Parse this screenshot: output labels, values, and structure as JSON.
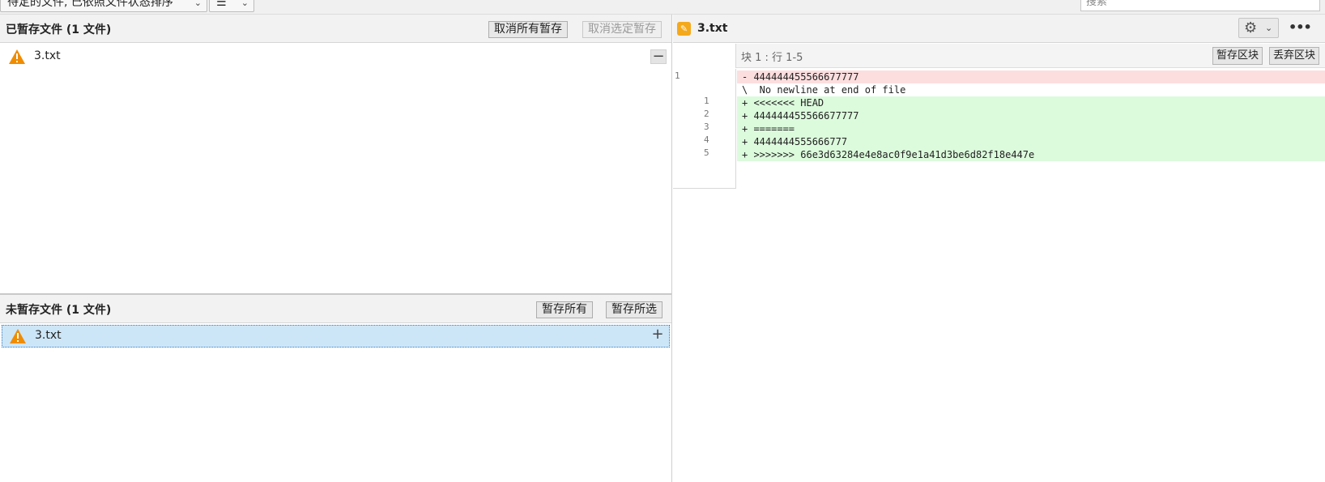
{
  "toolbar": {
    "sort_combo": "待定的文件, 已依照文件状态排序",
    "view_combo": "☰",
    "search_placeholder": "搜索"
  },
  "staged": {
    "title": "已暂存文件  (1 文件)",
    "unstage_all": "取消所有暂存",
    "unstage_selected": "取消选定暂存",
    "files": [
      {
        "name": "3.txt"
      }
    ]
  },
  "unstaged": {
    "title": "未暂存文件  (1 文件)",
    "stage_all": "暂存所有",
    "stage_selected": "暂存所选",
    "files": [
      {
        "name": "3.txt"
      }
    ]
  },
  "diff": {
    "file_name": "3.txt",
    "hunk_label": "块 1 :  行 1-5",
    "stage_hunk": "暂存区块",
    "discard_hunk": "丢弃区块",
    "lines": [
      {
        "type": "del",
        "old": "1",
        "new": "",
        "text": "- 444444455566677777"
      },
      {
        "type": "ctx",
        "old": "",
        "new": "",
        "text": "\\  No newline at end of file"
      },
      {
        "type": "add",
        "old": "",
        "new": "1",
        "text": "+ <<<<<<< HEAD"
      },
      {
        "type": "add",
        "old": "",
        "new": "2",
        "text": "+ 444444455566677777"
      },
      {
        "type": "add",
        "old": "",
        "new": "3",
        "text": "+ ======="
      },
      {
        "type": "add",
        "old": "",
        "new": "4",
        "text": "+ 4444444555666777"
      },
      {
        "type": "add",
        "old": "",
        "new": "5",
        "text": "+ >>>>>>> 66e3d63284e4e8ac0f9e1a41d3be6d82f18e447e"
      }
    ]
  },
  "colors": {
    "warning": "#f08c00",
    "selection": "#cde6f7",
    "deleted_line": "#fddedf",
    "added_line": "#dcfadc",
    "edit_badge": "#f4a91c"
  },
  "icons": [
    "chevron-down-icon",
    "list-icon",
    "warning-icon",
    "minus-icon",
    "plus-icon",
    "edit-icon",
    "gear-icon",
    "more-icon"
  ]
}
